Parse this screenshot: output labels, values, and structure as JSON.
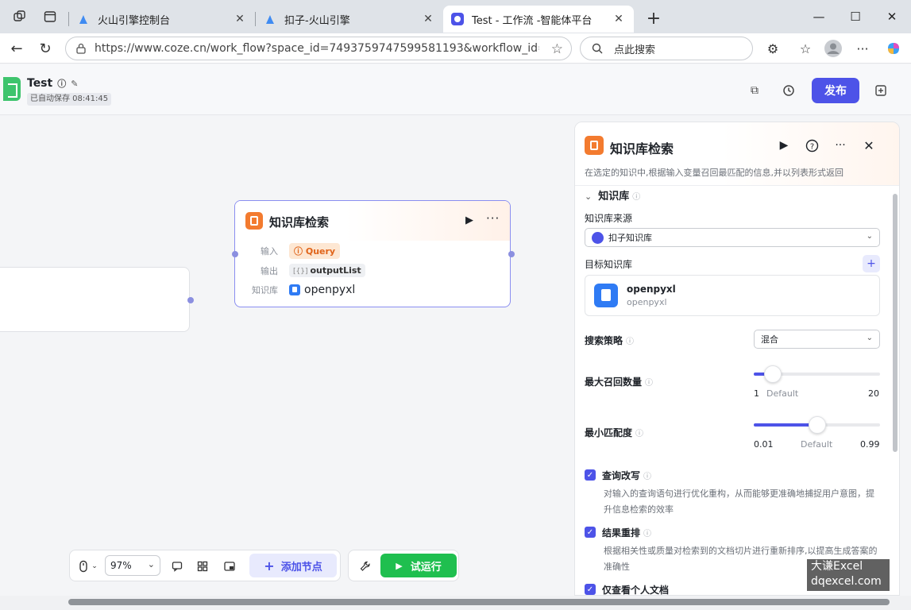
{
  "browser": {
    "tabs": [
      {
        "title": "火山引擎控制台"
      },
      {
        "title": "扣子-火山引擎"
      },
      {
        "title": "Test - 工作流 -智能体平台"
      }
    ],
    "url": "https://www.coze.cn/work_flow?space_id=7493759747599581193&workflow_id=7504162...",
    "search_placeholder": "点此搜索"
  },
  "app": {
    "title": "Test",
    "save_status": "已自动保存 08:41:45",
    "publish_label": "发布"
  },
  "node": {
    "title": "知识库检索",
    "input_label": "输入",
    "input_value": "Query",
    "output_label": "输出",
    "output_value": "outputList",
    "output_prefix": "[{}]",
    "kb_label": "知识库",
    "kb_value": "openpyxl"
  },
  "toolbar": {
    "zoom": "97%",
    "add_node": "添加节点",
    "run": "试运行"
  },
  "panel": {
    "title": "知识库检索",
    "description": "在选定的知识中,根据输入变量召回最匹配的信息,并以列表形式返回",
    "section": "知识库",
    "source_label": "知识库来源",
    "source_value": "扣子知识库",
    "target_label": "目标知识库",
    "kb_name": "openpyxl",
    "kb_sub": "openpyxl",
    "strategy_label": "搜索策略",
    "strategy_value": "混合",
    "max_recall": {
      "label": "最大召回数量",
      "min": "1",
      "default": "Default",
      "max": "20",
      "level": 0.05
    },
    "min_match": {
      "label": "最小匹配度",
      "min": "0.01",
      "default": "Default",
      "max": "0.99",
      "level": 0.5
    },
    "query_rewrite": {
      "label": "查询改写",
      "desc": "对输入的查询语句进行优化重构，从而能够更准确地捕捉用户意图，提升信息检索的效率"
    },
    "rerank": {
      "label": "结果重排",
      "desc": "根据相关性或质量对检索到的文档切片进行重新排序,以提高生成答案的准确性"
    },
    "partial_label": "仅查看个人文档"
  },
  "watermark": {
    "line1": "大谦Excel",
    "line2": "dqexcel.com"
  },
  "colors": {
    "accent": "#4d53e8",
    "run": "#1fbf4f",
    "kb_orange": "#f37b2f"
  }
}
